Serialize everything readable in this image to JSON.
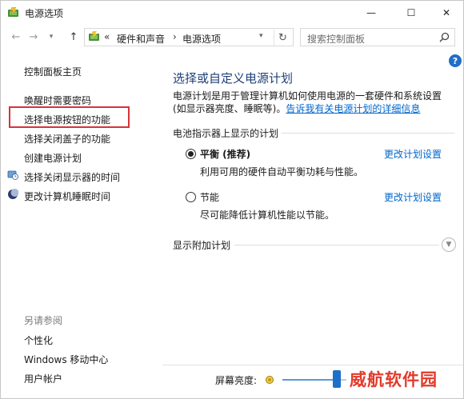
{
  "window": {
    "title": "电源选项",
    "minimize_glyph": "—",
    "maximize_glyph": "☐",
    "close_glyph": "✕"
  },
  "addressbar": {
    "back_glyph": "←",
    "forward_glyph": "→",
    "up_glyph": "↑",
    "overflow": "«",
    "crumbs": [
      "硬件和声音",
      "电源选项"
    ],
    "separator": "›",
    "refresh_glyph": "↻",
    "search_placeholder": "搜索控制面板"
  },
  "sidebar": {
    "home": "控制面板主页",
    "items": [
      {
        "label": "唤醒时需要密码",
        "icon": null
      },
      {
        "label": "选择电源按钮的功能",
        "icon": null,
        "highlighted": true
      },
      {
        "label": "选择关闭盖子的功能",
        "icon": null
      },
      {
        "label": "创建电源计划",
        "icon": null
      },
      {
        "label": "选择关闭显示器的时间",
        "icon": "monitor-clock-icon"
      },
      {
        "label": "更改计算机睡眠时间",
        "icon": "moon-sleep-icon"
      }
    ],
    "see_also_heading": "另请参阅",
    "see_also": [
      "个性化",
      "Windows 移动中心",
      "用户帐户"
    ]
  },
  "main": {
    "title": "选择或自定义电源计划",
    "intro_text": "电源计划是用于管理计算机如何使用电源的一套硬件和系统设置(如显示器亮度、睡眠等)。",
    "intro_link": "告诉我有关电源计划的详细信息",
    "section_label": "电池指示器上显示的计划",
    "plans": [
      {
        "name": "平衡 (推荐)",
        "selected": true,
        "description": "利用可用的硬件自动平衡功耗与性能。",
        "link": "更改计划设置"
      },
      {
        "name": "节能",
        "selected": false,
        "description": "尽可能降低计算机性能以节能。",
        "link": "更改计划设置"
      }
    ],
    "more_plans_label": "显示附加计划",
    "help_glyph": "?",
    "more_chevron": "⌄"
  },
  "footer": {
    "brightness_label": "屏幕亮度:",
    "brightness_level": 0.85,
    "watermark": "威航软件园"
  },
  "colors": {
    "accent": "#1e6fc9",
    "link": "#0066cc",
    "title": "#1e3f7a",
    "highlight_border": "#d63339",
    "watermark": "#e23a2a"
  }
}
